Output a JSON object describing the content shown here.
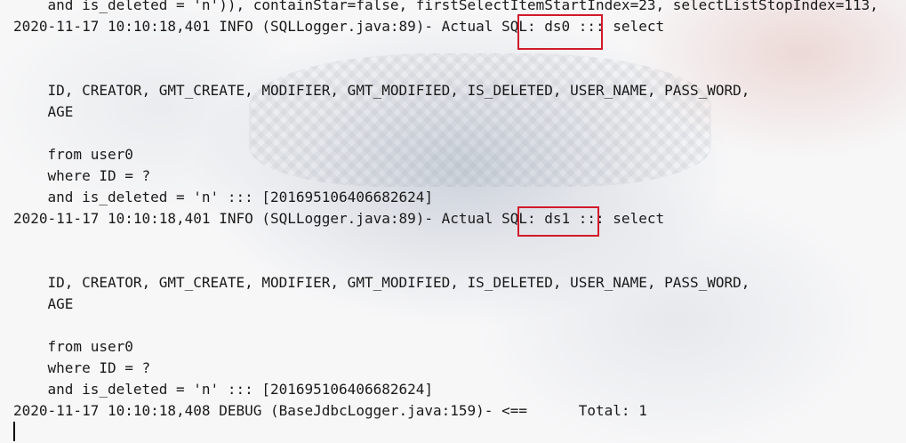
{
  "console": {
    "lines": [
      "    and is_deleted = 'n')), containStar=false, firstSelectItemStartIndex=23, selectListStopIndex=113,",
      "2020-11-17 10:10:18,401 INFO (SQLLogger.java:89)- Actual SQL: ds0 ::: select",
      "",
      "",
      "    ID, CREATOR, GMT_CREATE, MODIFIER, GMT_MODIFIED, IS_DELETED, USER_NAME, PASS_WORD,",
      "    AGE",
      "",
      "    from user0",
      "    where ID = ?",
      "    and is_deleted = 'n' ::: [201695106406682624]",
      "2020-11-17 10:10:18,401 INFO (SQLLogger.java:89)- Actual SQL: ds1 ::: select",
      "",
      "",
      "    ID, CREATOR, GMT_CREATE, MODIFIER, GMT_MODIFIED, IS_DELETED, USER_NAME, PASS_WORD,",
      "    AGE",
      "",
      "    from user0",
      "    where ID = ?",
      "    and is_deleted = 'n' ::: [201695106406682624]",
      "2020-11-17 10:10:18,408 DEBUG (BaseJdbcLogger.java:159)- <==      Total: 1"
    ]
  },
  "highlight_color": "#d11a2a"
}
